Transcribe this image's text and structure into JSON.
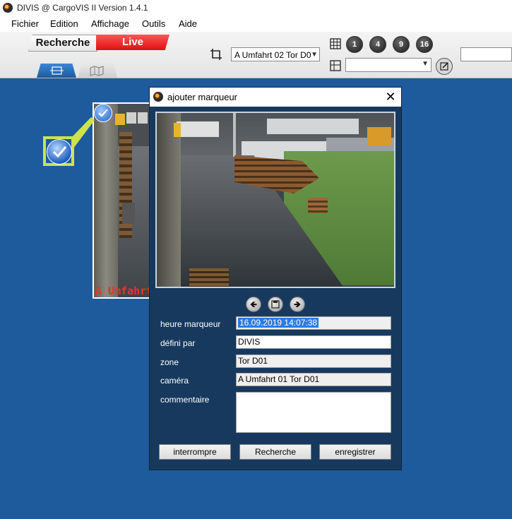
{
  "window": {
    "title": "DIVIS @ CargoVIS II Version 1.4.1"
  },
  "menu": {
    "items": [
      "Fichier",
      "Edition",
      "Affichage",
      "Outils",
      "Aide"
    ]
  },
  "toolbar": {
    "mode_recherche": "Recherche",
    "mode_live": "Live",
    "camera_select_value": "A Umfahrt 02 Tor D0",
    "layout_buttons": [
      "1",
      "4",
      "9",
      "16"
    ],
    "layout_select_value": "",
    "search_value": ""
  },
  "tile": {
    "overlay_text": "A Umfahrt"
  },
  "dialog": {
    "title": "ajouter marqueur",
    "labels": {
      "heure": "heure marqueur",
      "defini": "défini par",
      "zone": "zone",
      "camera": "caméra",
      "commentaire": "commentaire"
    },
    "values": {
      "heure": "16.09.2019 14:07:38",
      "defini": "DIVIS",
      "zone": "Tor D01",
      "camera": "A Umfahrt 01 Tor D01",
      "commentaire": ""
    },
    "buttons": {
      "interrompre": "interrompre",
      "recherche": "Recherche",
      "enregistrer": "enregistrer"
    }
  },
  "colors": {
    "background": "#1e5b9c",
    "live": "#e01010",
    "dialog": "#17395e",
    "marker_highlight": "#cde34a",
    "overlay_text": "#ff2a2a"
  }
}
